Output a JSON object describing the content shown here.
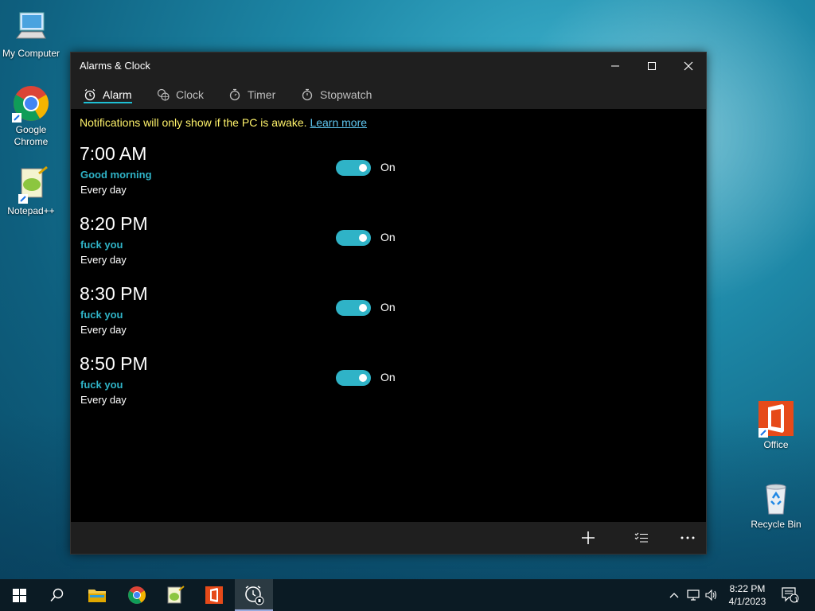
{
  "desktop": {
    "icons": [
      {
        "label": "My Computer",
        "icon": "computer-icon"
      },
      {
        "label": "Google Chrome",
        "icon": "chrome-icon"
      },
      {
        "label": "Notepad++",
        "icon": "notepad-plus-plus-icon"
      },
      {
        "label": "Office",
        "icon": "office-icon"
      },
      {
        "label": "Recycle Bin",
        "icon": "recycle-bin-icon"
      }
    ]
  },
  "window": {
    "title": "Alarms & Clock",
    "tabs": [
      {
        "label": "Alarm",
        "icon": "alarm-icon",
        "active": true
      },
      {
        "label": "Clock",
        "icon": "world-clock-icon",
        "active": false
      },
      {
        "label": "Timer",
        "icon": "timer-icon",
        "active": false
      },
      {
        "label": "Stopwatch",
        "icon": "stopwatch-icon",
        "active": false
      }
    ],
    "notice": {
      "text": "Notifications will only show if the PC is awake.",
      "link": "Learn more"
    },
    "alarms": [
      {
        "time": "7:00 AM",
        "name": "Good morning",
        "repeat": "Every day",
        "state": "On"
      },
      {
        "time": "8:20 PM",
        "name": "fuck you",
        "repeat": "Every day",
        "state": "On"
      },
      {
        "time": "8:30 PM",
        "name": "fuck you",
        "repeat": "Every day",
        "state": "On"
      },
      {
        "time": "8:50 PM",
        "name": "fuck you",
        "repeat": "Every day",
        "state": "On"
      }
    ]
  },
  "taskbar": {
    "time": "8:22 PM",
    "date": "4/1/2023",
    "notification_count": "1"
  },
  "colors": {
    "accent": "#2fb3c7",
    "notice": "#fff36b",
    "link": "#5fc6f0"
  }
}
